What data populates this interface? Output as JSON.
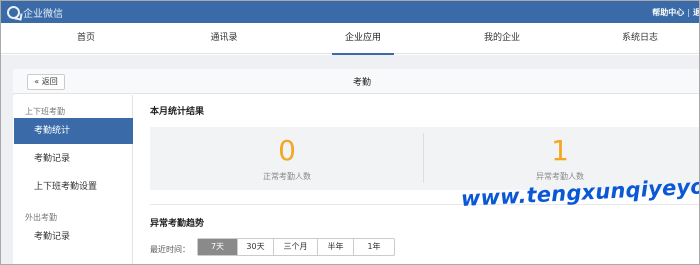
{
  "app": {
    "logo_text": "企业微信",
    "header_right": [
      "帮助中心",
      "|",
      "退"
    ]
  },
  "nav": {
    "items": [
      "首页",
      "通讯录",
      "企业应用",
      "我的企业",
      "系统日志"
    ],
    "active": "企业应用"
  },
  "page": {
    "back_label": "« 返回",
    "title": "考勤"
  },
  "sidebar": {
    "groups": [
      {
        "title": "上下班考勤",
        "items": [
          "考勤统计",
          "考勤记录",
          "上下班考勤设置"
        ]
      },
      {
        "title": "外出考勤",
        "items": [
          "考勤记录"
        ]
      }
    ],
    "active": "考勤统计"
  },
  "stats": {
    "section_title": "本月统计结果",
    "normal": {
      "value": "0",
      "label": "正常考勤人数"
    },
    "abnormal": {
      "value": "1",
      "label": "异常考勤人数"
    }
  },
  "trend": {
    "section_title": "异常考勤趋势",
    "filter_label": "最近时间：",
    "ranges": [
      "7天",
      "30天",
      "三个月",
      "半年",
      "1年"
    ],
    "active_range": "7天"
  },
  "watermark": "www.tengxunqiyeyou.com",
  "colors": {
    "brand": "#3a6aa7",
    "stat_value": "#f5a623",
    "watermark": "#0a58d6"
  }
}
